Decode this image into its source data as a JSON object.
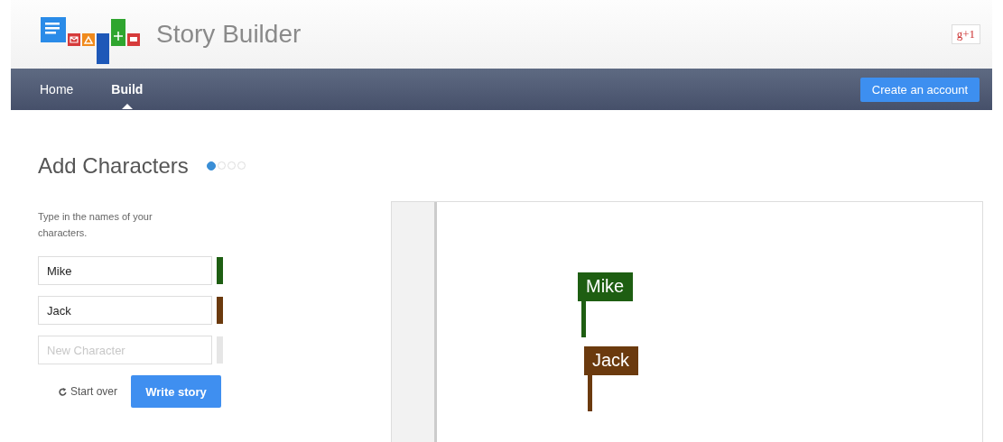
{
  "header": {
    "title": "Story Builder",
    "plus_button": "g+1"
  },
  "nav": {
    "items": [
      {
        "label": "Home",
        "selected": false
      },
      {
        "label": "Build",
        "selected": true
      }
    ],
    "account_button": "Create an account"
  },
  "page": {
    "heading": "Add Characters",
    "steps": [
      {
        "selected": true
      },
      {
        "selected": false
      },
      {
        "selected": false
      },
      {
        "selected": false
      }
    ],
    "instructions": "Type in the names of your characters.",
    "characters": [
      {
        "value": "Mike",
        "color": "#1e5e12"
      },
      {
        "value": "Jack",
        "color": "#6b3a0e"
      },
      {
        "placeholder": "New Character",
        "color": "#e6e6e6"
      }
    ],
    "start_over": "Start over",
    "write_story": "Write story"
  },
  "canvas": {
    "flags": [
      {
        "label": "Mike",
        "color": "#1e5e12"
      },
      {
        "label": "Jack",
        "color": "#6b3a0e"
      }
    ]
  }
}
